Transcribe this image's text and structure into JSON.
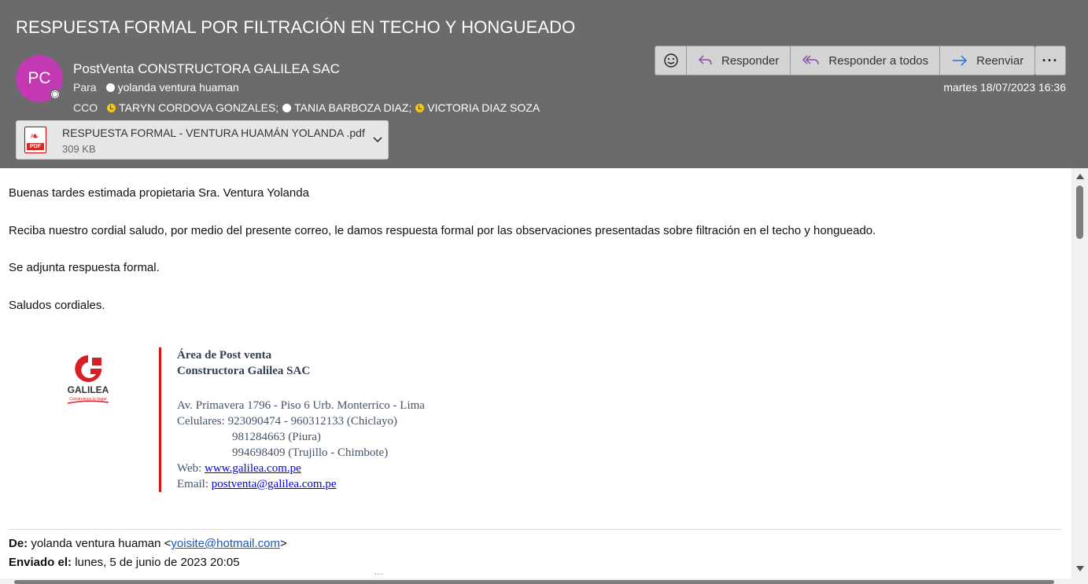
{
  "email": {
    "subject": "RESPUESTA FORMAL POR FILTRACIÓN EN TECHO Y HONGUEADO",
    "avatar_initials": "PC",
    "avatar_color": "#c239b3",
    "sender": "PostVenta CONSTRUCTORA GALILEA SAC",
    "to_label": "Para",
    "to": "yolanda ventura huaman",
    "cco_label": "CCO",
    "cco": [
      "TARYN CORDOVA GONZALES;",
      "TANIA BARBOZA DIAZ;",
      "VICTORIA DIAZ SOZA"
    ],
    "date": "martes 18/07/2023 16:36"
  },
  "attachment": {
    "name": "RESPUESTA FORMAL - VENTURA HUAMÁN YOLANDA .pdf",
    "size": "309 KB",
    "icon": "pdf-icon",
    "icon_label": "PDF"
  },
  "toolbar": {
    "emoji_icon": "smiley-icon",
    "reply_label": "Responder",
    "reply_all_label": "Responder a todos",
    "forward_label": "Reenviar",
    "more_label": "···"
  },
  "body": {
    "greeting": "Buenas tardes estimada propietaria Sra. Ventura Yolanda",
    "paragraph1": "Reciba nuestro cordial saludo, por medio del presente correo, le damos respuesta formal por las observaciones presentadas sobre filtración en el techo y hongueado.",
    "paragraph2": "Se adjunta respuesta formal.",
    "closing": "Saludos cordiales."
  },
  "signature": {
    "logo_text": "GALILEA",
    "logo_tagline": "Construimos tu hogar",
    "line1": "Área de Post venta",
    "line2": "Constructora Galilea SAC",
    "address": "Av. Primavera 1796 - Piso 6 Urb. Monterrico - Lima",
    "phones_label": "Celulares:",
    "phone1": "923090474 - 960312133 (Chiclayo)",
    "phone2": "981284663 (Piura)",
    "phone3": "994698409 (Trujillo - Chimbote)",
    "web_label": "Web:",
    "web": "www.galilea.com.pe",
    "email_label": "Email:",
    "email": "postventa@galilea.com.pe"
  },
  "quoted": {
    "from_label": "De:",
    "from_name": "yolanda ventura huaman <",
    "from_email": "yoisite@hotmail.com",
    "from_close": ">",
    "sent_label": "Enviado el:",
    "sent_value": "lunes, 5 de junio de 2023 20:05",
    "more": "..."
  }
}
